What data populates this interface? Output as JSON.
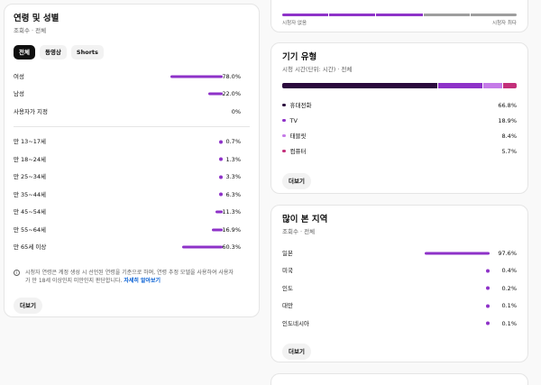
{
  "audience": {
    "title": "연령 및 성별",
    "subtitle": "조회수 · 전체",
    "chips": [
      "전체",
      "동영상",
      "Shorts"
    ],
    "gender": [
      {
        "label": "여성",
        "value": "78.0%",
        "pct": 78.0
      },
      {
        "label": "남성",
        "value": "22.0%",
        "pct": 22.0
      },
      {
        "label": "사용자가 지정",
        "value": "0%",
        "pct": 0
      }
    ],
    "age": [
      {
        "label": "만 13~17세",
        "value": "0.7%",
        "pct": 0.7
      },
      {
        "label": "만 18~24세",
        "value": "1.3%",
        "pct": 1.3
      },
      {
        "label": "만 25~34세",
        "value": "3.3%",
        "pct": 3.3
      },
      {
        "label": "만 35~44세",
        "value": "6.3%",
        "pct": 6.3
      },
      {
        "label": "만 45~54세",
        "value": "11.3%",
        "pct": 11.3
      },
      {
        "label": "만 55~64세",
        "value": "16.9%",
        "pct": 16.9
      },
      {
        "label": "만 65세 이상",
        "value": "60.3%",
        "pct": 60.3
      }
    ],
    "note_text": "시청자 연령은 계정 생성 시 선언된 연령을 기준으로 하며, 연령 추정 모델을 사용하여 사용자가 만 18세 이상인지 미만인지 판단합니다. ",
    "note_link": "자세히 알아보기",
    "more_label": "더보기"
  },
  "top_card": {
    "label_left": "시청자 없음",
    "label_right": "시청자 최다"
  },
  "device": {
    "title": "기기 유형",
    "subtitle": "시청 시간(단위: 시간) · 전체",
    "items": [
      {
        "label": "휴대전화",
        "value": "66.8%",
        "pct": 66.8,
        "color": "#2b0a3d"
      },
      {
        "label": "TV",
        "value": "18.9%",
        "pct": 18.9,
        "color": "#8e32c8"
      },
      {
        "label": "태블릿",
        "value": "8.4%",
        "pct": 8.4,
        "color": "#c57be8"
      },
      {
        "label": "컴퓨터",
        "value": "5.7%",
        "pct": 5.7,
        "color": "#c3307a"
      }
    ],
    "more_label": "더보기"
  },
  "geo": {
    "title": "많이 본 지역",
    "subtitle": "조회수 · 전체",
    "items": [
      {
        "label": "일본",
        "value": "97.6%",
        "pct": 97.6
      },
      {
        "label": "미국",
        "value": "0.4%",
        "pct": 0.4
      },
      {
        "label": "인도",
        "value": "0.2%",
        "pct": 0.2
      },
      {
        "label": "대만",
        "value": "0.1%",
        "pct": 0.1
      },
      {
        "label": "인도네시아",
        "value": "0.1%",
        "pct": 0.1
      }
    ],
    "more_label": "더보기"
  },
  "colors": {
    "accent": "#8e32c8",
    "link": "#065fd4"
  }
}
